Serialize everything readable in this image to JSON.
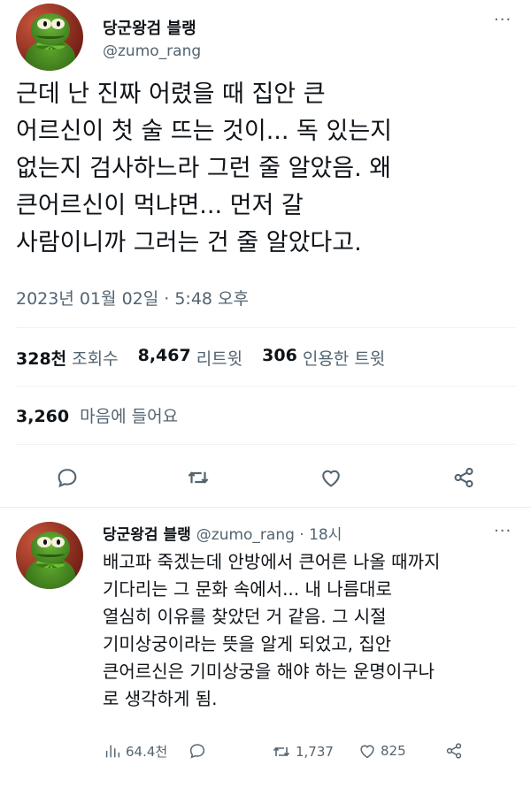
{
  "main_tweet": {
    "display_name": "당군왕검 블랭",
    "handle": "@zumo_rang",
    "more_icon": "···",
    "text": "근데 난 진짜 어렸을 때 집안 큰\n어르신이 첫 술 뜨는 것이... 독 있는지\n없는지 검사하느라 그런 줄 알았음. 왜\n큰어르신이 먹냐면... 먼저 갈\n사람이니까 그러는 건 줄 알았다고.",
    "timestamp": "2023년 01월 02일 · 5:48 오후",
    "stats": {
      "views_num": "328천",
      "views_label": "조회수",
      "retweets_num": "8,467",
      "retweets_label": "리트윗",
      "quotes_num": "306",
      "quotes_label": "인용한 트윗",
      "likes_num": "3,260",
      "likes_label": "마음에 들어요"
    },
    "actions": [
      "reply-icon",
      "retweet-icon",
      "like-icon",
      "share-icon"
    ]
  },
  "reply_tweet": {
    "display_name": "당군왕검 블랭",
    "handle_time": "@zumo_rang · 18시",
    "more_icon": "···",
    "text": "배고파 죽겠는데 안방에서 큰어른 나올 때까지\n기다리는 그 문화 속에서... 내 나름대로\n열심히 이유를 찾았던 거 같음. 그 시절\n기미상궁이라는 뜻을 알게 되었고, 집안\n큰어르신은 기미상궁을 해야 하는 운명이구나\n로 생각하게 됨.",
    "actions": {
      "views": "64.4천",
      "replies": "",
      "retweets": "1,737",
      "likes": "825"
    }
  },
  "colors": {
    "text": "#0f1419",
    "secondary": "#536471",
    "divider": "#eff3f4"
  }
}
